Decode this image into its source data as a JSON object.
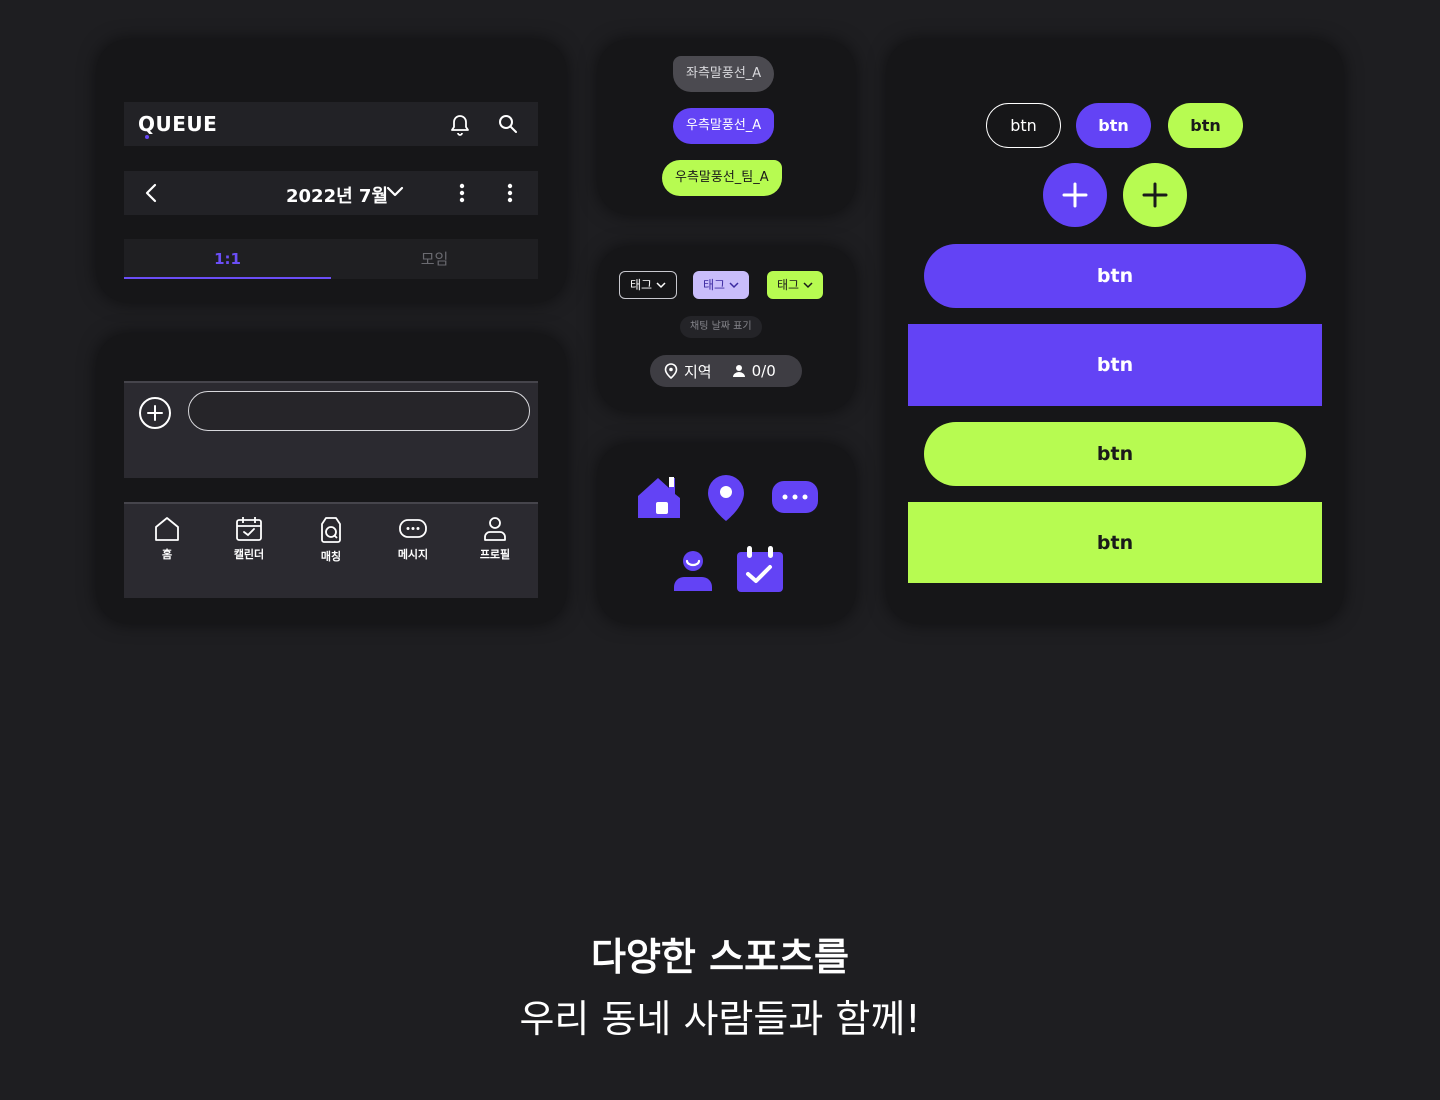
{
  "header": {
    "logo_text": "QUEUE",
    "month_label": "2022년 7월",
    "tabs": [
      {
        "label": "1:1",
        "active": true
      },
      {
        "label": "모임",
        "active": false
      }
    ]
  },
  "bottom_nav": {
    "items": [
      {
        "label": "홈",
        "icon": "home-icon"
      },
      {
        "label": "캘린더",
        "icon": "calendar-icon"
      },
      {
        "label": "매칭",
        "icon": "matching-icon"
      },
      {
        "label": "메시지",
        "icon": "message-icon"
      },
      {
        "label": "프로필",
        "icon": "profile-icon"
      }
    ]
  },
  "bubbles": {
    "left": "좌측말풍선_A",
    "right": "우측말풍선_A",
    "team": "우측말풍선_팀_A"
  },
  "tags": {
    "labels": [
      "태그",
      "태그",
      "태그"
    ],
    "date_label": "채팅 날짜 표기",
    "location": "지역",
    "count": "0/0"
  },
  "buttons": {
    "small": [
      "btn",
      "btn",
      "btn"
    ],
    "large": [
      "btn",
      "btn",
      "btn",
      "btn"
    ]
  },
  "tagline": {
    "line1": "다양한 스포츠를",
    "line2": "우리 동네 사람들과 함께!"
  },
  "colors": {
    "background": "#1e1e21",
    "card": "#161618",
    "purple": "#6343f5",
    "lime": "#b7fb51",
    "light_purple": "#c9bdfb"
  }
}
